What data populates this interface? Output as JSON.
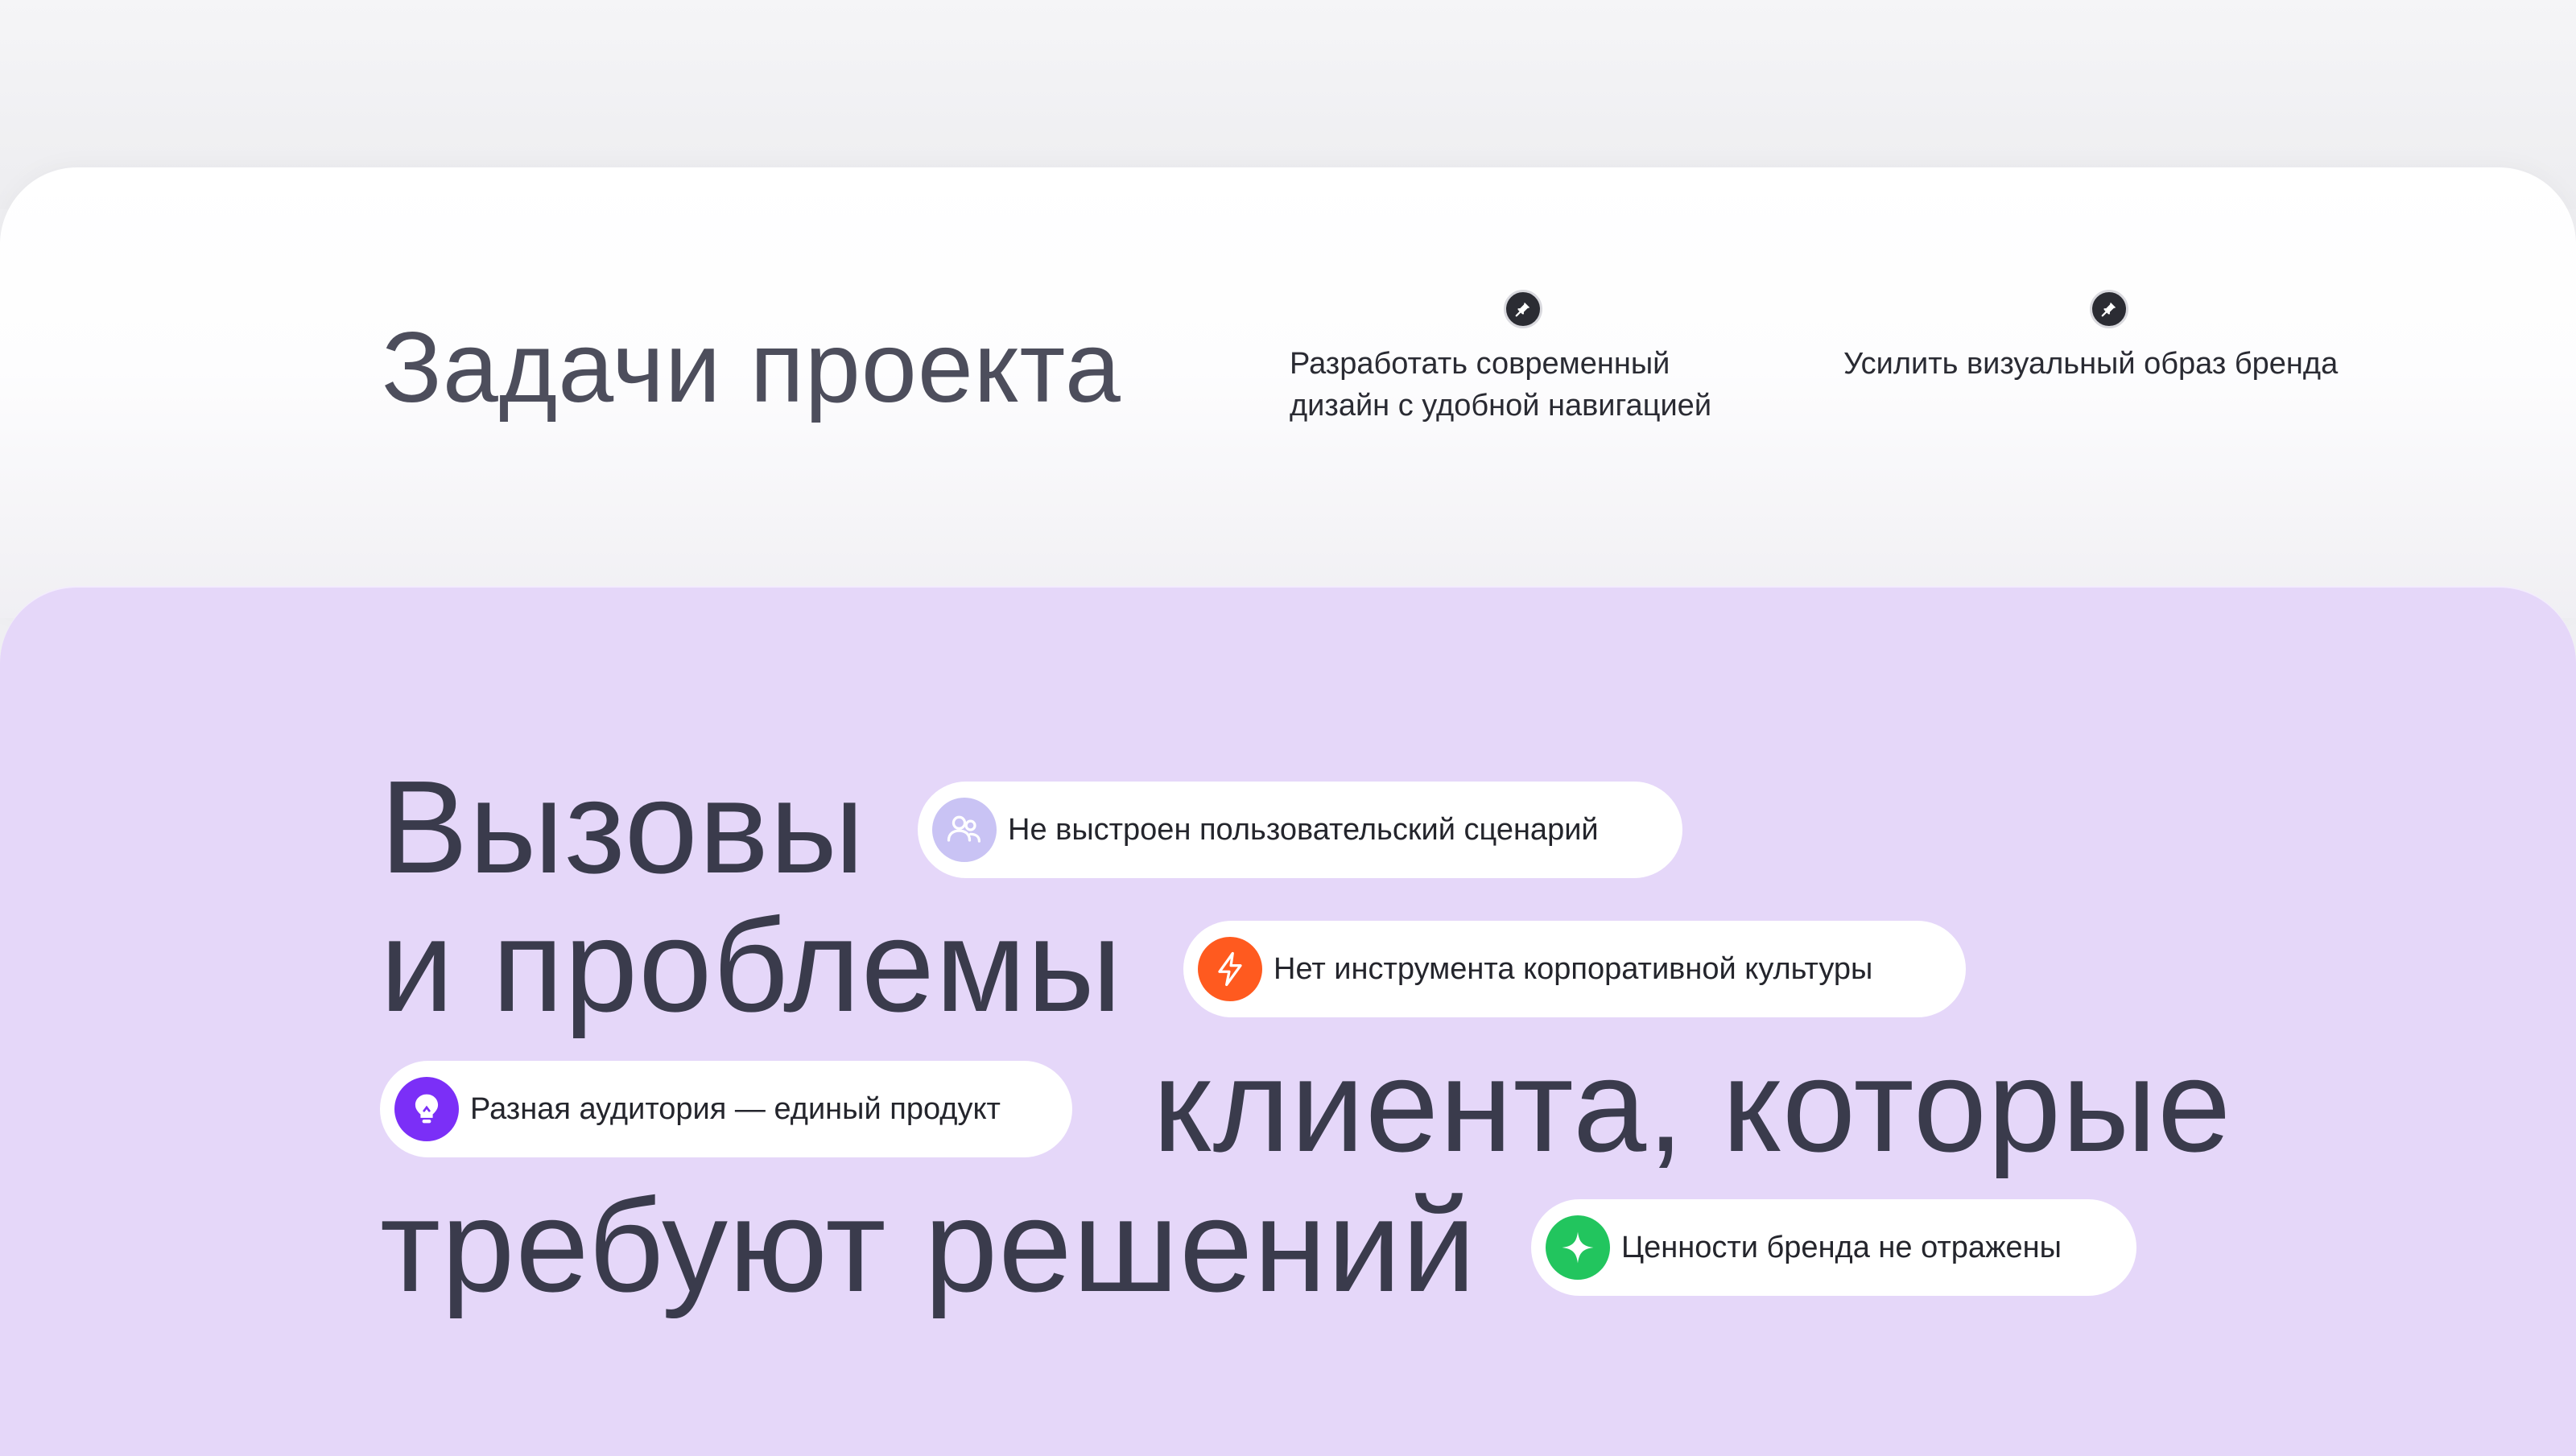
{
  "colors": {
    "background": "#efeff2",
    "tasks_card": "#ffffff",
    "challenges_card": "#e5d7f9",
    "heading_text": "#4d4e5c",
    "challenges_text": "#3a3b4c",
    "pill_bg": "#ffffff"
  },
  "tasks": {
    "title": "Задачи проекта",
    "items": [
      {
        "icon": "pin-icon",
        "text": "Разработать современный\nдизайн с удобной навигацией"
      },
      {
        "icon": "pin-icon",
        "text": "Усилить визуальный образ бренда"
      }
    ]
  },
  "challenges": {
    "heading_lines": [
      "Вызовы",
      "и проблемы",
      "клиента, которые",
      "требуют решений"
    ],
    "pills": [
      {
        "icon": "users-icon",
        "icon_color": "#c9c3f4",
        "text": "Не выстроен пользовательский сценарий"
      },
      {
        "icon": "lightning-icon",
        "icon_color": "#ff5a1f",
        "text": "Нет инструмента корпоративной культуры"
      },
      {
        "icon": "lightbulb-icon",
        "icon_color": "#7b2ff7",
        "text": "Разная аудитория — единый продукт"
      },
      {
        "icon": "sparkle-icon",
        "icon_color": "#22c55e",
        "text": "Ценности бренда не отражены"
      }
    ]
  }
}
